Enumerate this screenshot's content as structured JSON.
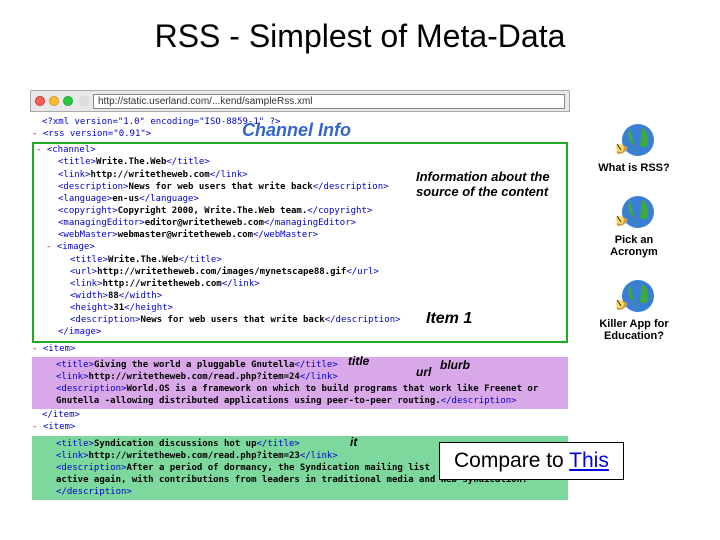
{
  "title": "RSS - Simplest of Meta-Data",
  "browser": {
    "url": "http://static.userland.com/...kend/sampleRss.xml"
  },
  "xml": {
    "l1": "<?xml version=\"1.0\" encoding=\"ISO-8859-1\" ?>",
    "rssOpen": "<rss version=\"0.91\">",
    "chanOpen": "<channel>",
    "titleO": "<title>",
    "titleV": "Write.The.Web",
    "titleC": "</title>",
    "linkO": "<link>",
    "linkV": "http://writetheweb.com",
    "linkC": "</link>",
    "descO": "<description>",
    "descV": "News for web users that write back",
    "descC": "</description>",
    "langO": "<language>",
    "langV": "en-us",
    "langC": "</language>",
    "copyO": "<copyright>",
    "copyV": "Copyright 2000, Write.The.Web team.",
    "copyC": "</copyright>",
    "medO": "<managingEditor>",
    "medV": "editor@writetheweb.com",
    "medC": "</managingEditor>",
    "wmO": "<webMaster>",
    "wmV": "webmaster@writetheweb.com",
    "wmC": "</webMaster>",
    "imgO": "<image>",
    "imgTitleO": "<title>",
    "imgTitleV": "Write.The.Web",
    "imgTitleC": "</title>",
    "imgUrlO": "<url>",
    "imgUrlV": "http://writetheweb.com/images/mynetscape88.gif",
    "imgUrlC": "</url>",
    "imgLinkO": "<link>",
    "imgLinkV": "http://writetheweb.com",
    "imgLinkC": "</link>",
    "imgWidthO": "<width>",
    "imgWidthV": "88",
    "imgWidthC": "</width>",
    "imgHeightO": "<height>",
    "imgHeightV": "31",
    "imgHeightC": "</height>",
    "imgDescO": "<description>",
    "imgDescV": "News for web users that write back",
    "imgDescC": "</description>",
    "imgC": "</image>",
    "itemO": "<item>",
    "i1TitleO": "<title>",
    "i1TitleV": "Giving the world a pluggable Gnutella",
    "i1TitleC": "</title>",
    "i1LinkO": "<link>",
    "i1LinkV": "http://writetheweb.com/read.php?item=24",
    "i1LinkC": "</link>",
    "i1DescO": "<description>",
    "i1DescV": "World.OS is a framework on which to build programs that work like Freenet or Gnutella -allowing distributed applications using peer-to-peer routing.",
    "i1DescC": "</description>",
    "itemC": "</item>",
    "i2TitleO": "<title>",
    "i2TitleV": "Syndication discussions hot up",
    "i2TitleC": "</title>",
    "i2LinkO": "<link>",
    "i2LinkV": "http://writetheweb.com/read.php?item=23",
    "i2LinkC": "</link>",
    "i2DescO": "<description>",
    "i2DescV": "After a period of dormancy, the Syndication mailing list",
    "i2DescVCont": "active again, with contributions from leaders in traditional media and Web syndication.",
    "i2DescC": "</description>"
  },
  "labels": {
    "channel": "Channel Info",
    "info": "Information about the source of the content",
    "item1": "Item 1",
    "titleLbl": "title",
    "urlLbl": "url",
    "blurbLbl": "blurb",
    "itLbl": "it"
  },
  "right": {
    "q1": "What is RSS?",
    "q2a": "Pick an",
    "q2b": "Acronym",
    "q3a": "Killer App for",
    "q3b": "Education?"
  },
  "compare": {
    "text": "Compare to ",
    "link": "This"
  }
}
